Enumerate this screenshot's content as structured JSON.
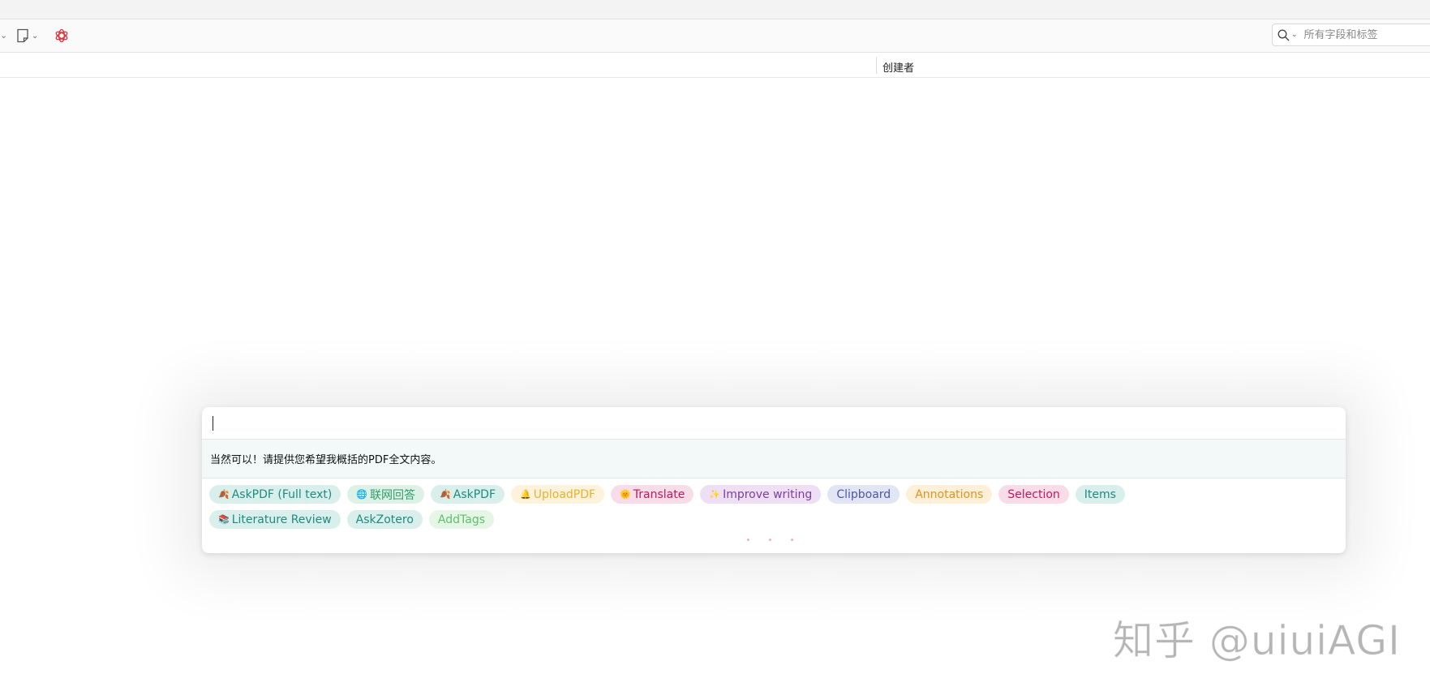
{
  "toolbar": {
    "icons": [
      "chevron-left-icon",
      "new-note-icon",
      "chevron-down-icon",
      "openai-logo-icon"
    ],
    "search": {
      "placeholder": "所有字段和标签",
      "value": ""
    }
  },
  "columns": {
    "creator": "创建者"
  },
  "assistant": {
    "input_value": "",
    "reply": "当然可以！请提供您希望我概括的PDF全文内容。",
    "dots": "• • •",
    "tags": [
      {
        "icon": "🍂",
        "label": "AskPDF (Full text)",
        "color": "#1f8a80",
        "bg": "#d9efec"
      },
      {
        "icon": "🌐",
        "label": "联网回答",
        "color": "#2e9a6a",
        "bg": "#def1e7"
      },
      {
        "icon": "🍂",
        "label": "AskPDF",
        "color": "#1f8a80",
        "bg": "#d9efec"
      },
      {
        "icon": "🔔",
        "label": "UploadPDF",
        "color": "#e8b02c",
        "bg": "#fdf3dc"
      },
      {
        "icon": "🌞",
        "label": "Translate",
        "color": "#c2185b",
        "bg": "#f8dde8"
      },
      {
        "icon": "✨",
        "label": "Improve writing",
        "color": "#7b3ea0",
        "bg": "#eedff4"
      },
      {
        "icon": "",
        "label": "Clipboard",
        "color": "#4a56a8",
        "bg": "#e2e5f4"
      },
      {
        "icon": "",
        "label": "Annotations",
        "color": "#e0941a",
        "bg": "#fdefd8"
      },
      {
        "icon": "",
        "label": "Selection",
        "color": "#c2185b",
        "bg": "#f8dde8"
      },
      {
        "icon": "",
        "label": "Items",
        "color": "#1f8a80",
        "bg": "#d9efec"
      },
      {
        "icon": "📚",
        "label": "Literature Review",
        "color": "#1f8a80",
        "bg": "#d9efec"
      },
      {
        "icon": "",
        "label": "AskZotero",
        "color": "#1f8a80",
        "bg": "#d9efec"
      },
      {
        "icon": "",
        "label": "AddTags",
        "color": "#5cc06a",
        "bg": "#e6f6e6"
      }
    ]
  },
  "watermark": "知乎 @uiuiAGI"
}
